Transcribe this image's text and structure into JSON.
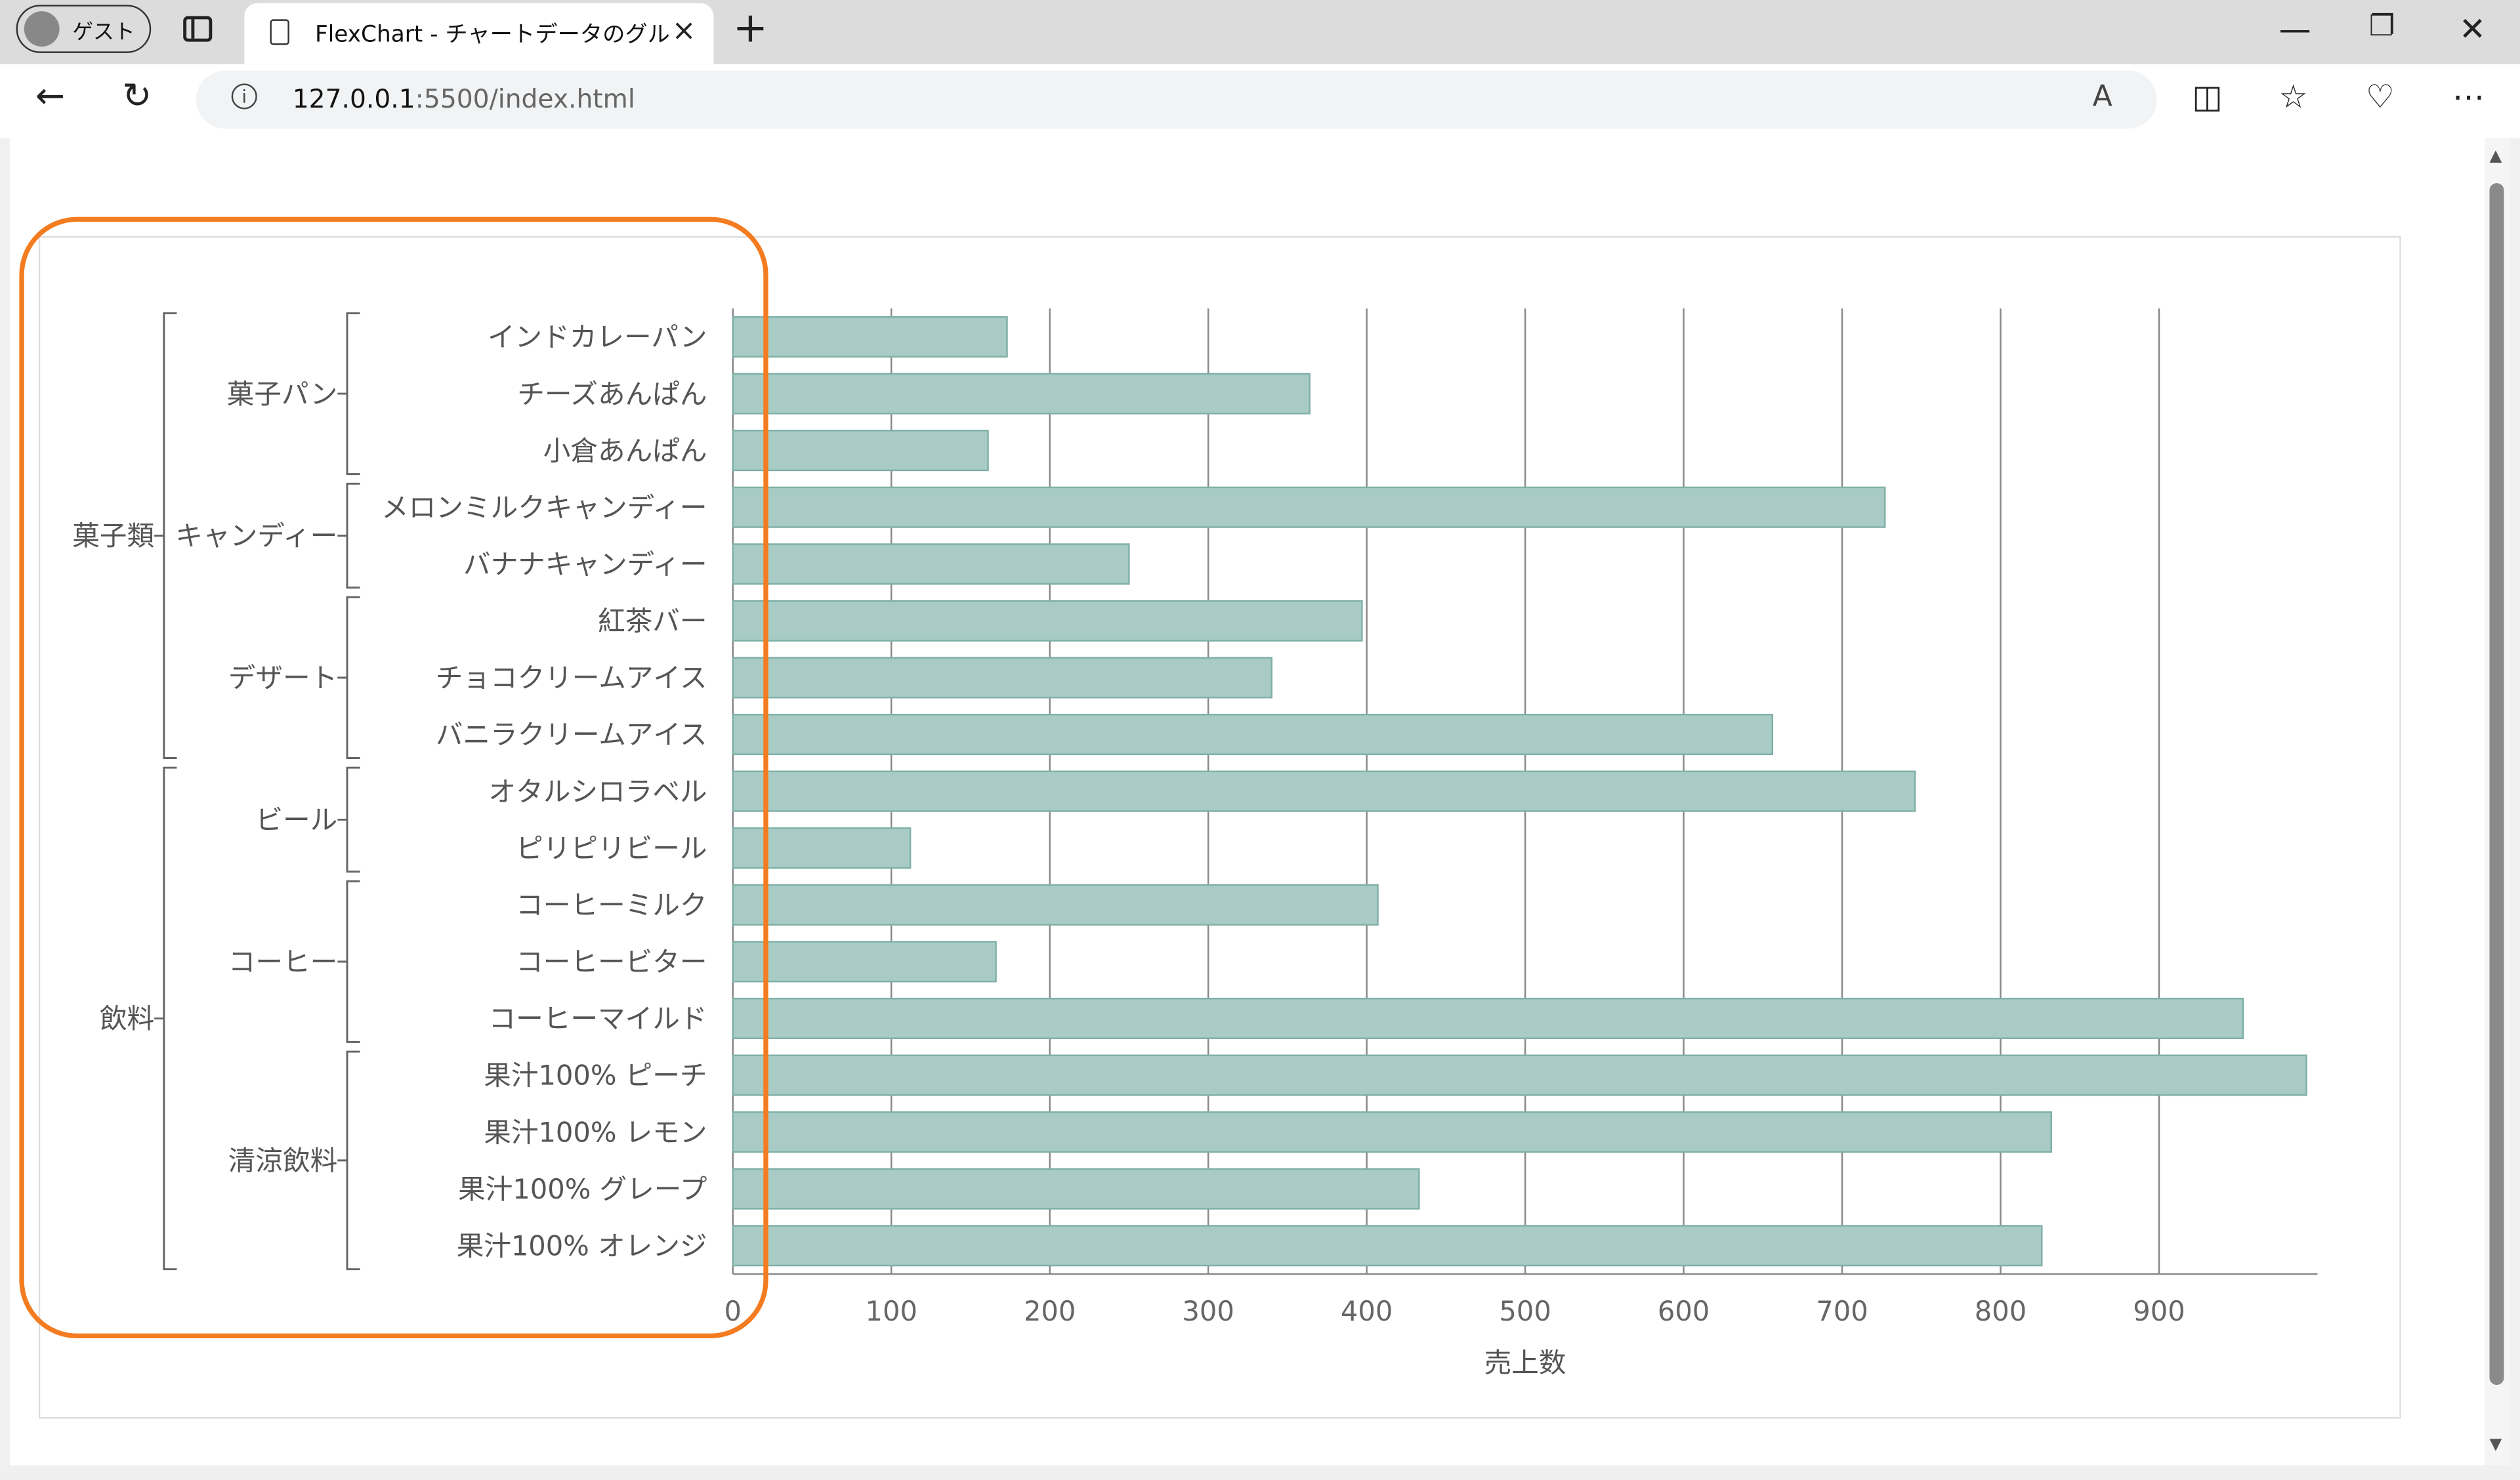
{
  "browser": {
    "profile_label": "ゲスト",
    "tab_title": "FlexChart - チャートデータのグループ化",
    "new_tab_symbol": "+",
    "address_host": "127.0.0.1",
    "address_rest": ":5500/index.html",
    "window_controls": {
      "minimize": "—",
      "restore": "❐",
      "close": "✕"
    },
    "icons": [
      "back-icon",
      "reload-icon",
      "info-icon",
      "read-aloud-icon",
      "split-screen-icon",
      "favorites-icon",
      "browser-essentials-icon",
      "more-icon"
    ]
  },
  "annotation": {
    "color": "#f47c20"
  },
  "chart_data": {
    "type": "bar",
    "orientation": "horizontal",
    "title": "",
    "xlabel": "売上数",
    "ylabel": "",
    "xlim": [
      0,
      1000
    ],
    "xticks": [
      0,
      100,
      200,
      300,
      400,
      500,
      600,
      700,
      800,
      900
    ],
    "grid": "vertical",
    "bar_color": "#a8cbc5",
    "bar_edge_color": "#7fb0a7",
    "categories": [
      "インドカレーパン",
      "チーズあんぱん",
      "小倉あんぱん",
      "メロンミルクキャンディー",
      "バナナキャンディー",
      "紅茶バー",
      "チョコクリームアイス",
      "バニラクリームアイス",
      "オタルシロラベル",
      "ピリピリビール",
      "コーヒーミルク",
      "コーヒービター",
      "コーヒーマイルド",
      "果汁100% ピーチ",
      "果汁100% レモン",
      "果汁100% グレープ",
      "果汁100% オレンジ"
    ],
    "values": [
      173,
      364,
      161,
      727,
      250,
      397,
      340,
      656,
      746,
      112,
      407,
      166,
      953,
      993,
      832,
      433,
      826
    ],
    "groups_level2": [
      {
        "label": "菓子パン",
        "start": 0,
        "end": 2
      },
      {
        "label": "キャンディー",
        "start": 3,
        "end": 4
      },
      {
        "label": "デザート",
        "start": 5,
        "end": 7
      },
      {
        "label": "ビール",
        "start": 8,
        "end": 9
      },
      {
        "label": "コーヒー",
        "start": 10,
        "end": 12
      },
      {
        "label": "清涼飲料",
        "start": 13,
        "end": 16
      }
    ],
    "groups_level1": [
      {
        "label": "菓子類",
        "start": 0,
        "end": 7
      },
      {
        "label": "飲料",
        "start": 8,
        "end": 16
      }
    ]
  }
}
